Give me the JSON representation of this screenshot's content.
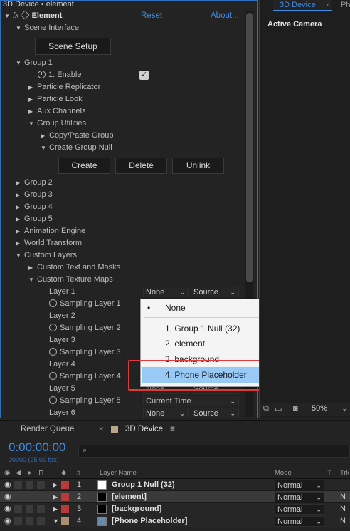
{
  "titlebar": {
    "title": "3D Device • element"
  },
  "effect_header": {
    "fx": "fx",
    "name": "Element",
    "reset": "Reset",
    "about": "About..."
  },
  "tree": {
    "scene_interface": "Scene Interface",
    "scene_setup": "Scene Setup",
    "group1": "Group 1",
    "enable": "1. Enable",
    "particle_replicator": "Particle Replicator",
    "particle_look": "Particle Look",
    "aux_channels": "Aux Channels",
    "group_utilities": "Group Utilities",
    "copy_paste_group": "Copy/Paste Group",
    "create_group_null": "Create Group Null",
    "create": "Create",
    "delete": "Delete",
    "unlink": "Unlink",
    "group2": "Group 2",
    "group3": "Group 3",
    "group4": "Group 4",
    "group5": "Group 5",
    "animation_engine": "Animation Engine",
    "world_transform": "World Transform",
    "custom_layers": "Custom Layers",
    "custom_text_masks": "Custom Text and Masks",
    "custom_texture_maps": "Custom Texture Maps",
    "layer1": "Layer 1",
    "sampling_layer1": "Sampling Layer 1",
    "layer2": "Layer 2",
    "sampling_layer2": "Sampling Layer 2",
    "layer3": "Layer 3",
    "sampling_layer3": "Sampling Layer 3",
    "layer4": "Layer 4",
    "sampling_layer4": "Sampling Layer 4",
    "layer5": "Layer 5",
    "sampling_layer5": "Sampling Layer 5",
    "layer6": "Layer 6"
  },
  "selects": {
    "layer1_value": "None",
    "layer1_source": "Source",
    "layer5_value": "None",
    "layer5_source": "Source",
    "sampling5_value": "Current Time",
    "layer6_value": "None",
    "layer6_source": "Source"
  },
  "dropdown": {
    "items": [
      "None",
      "1. Group 1 Null (32)",
      "2. element",
      "3. background",
      "4. Phone Placeholder"
    ],
    "selected_index": 0,
    "highlighted_index": 4
  },
  "right_panel": {
    "tab": "3D Device",
    "tab2": "Ph",
    "active_camera": "Active Camera",
    "zoom": "50%"
  },
  "timeline": {
    "render_queue": "Render Queue",
    "comp_tab": "3D Device",
    "timecode": "0:00:00:00",
    "frames": "00000 (25.00 fps)",
    "search_placeholder": "",
    "col_num": "#",
    "col_layer_name": "Layer Name",
    "col_mode": "Mode",
    "col_t": "T",
    "col_trk": "TrkI",
    "layers": [
      {
        "num": "1",
        "name": "Group 1 Null (32)",
        "mode": "Normal",
        "color": "#b83a3a",
        "thumb": "#ffffff",
        "trk": ""
      },
      {
        "num": "2",
        "name": "[element]",
        "mode": "Normal",
        "color": "#b83a3a",
        "thumb": "#000000",
        "trk": "N"
      },
      {
        "num": "3",
        "name": "[background]",
        "mode": "Normal",
        "color": "#b83a3a",
        "thumb": "#000000",
        "trk": "N"
      },
      {
        "num": "4",
        "name": "[Phone Placeholder]",
        "mode": "Normal",
        "color": "#a89070",
        "thumb": "#6a8aa8",
        "trk": "N"
      }
    ]
  },
  "colors": {
    "accent_blue": "#3d8fe8",
    "highlight_box": "#e03b3b",
    "dropdown_highlight": "#99c9f5"
  }
}
